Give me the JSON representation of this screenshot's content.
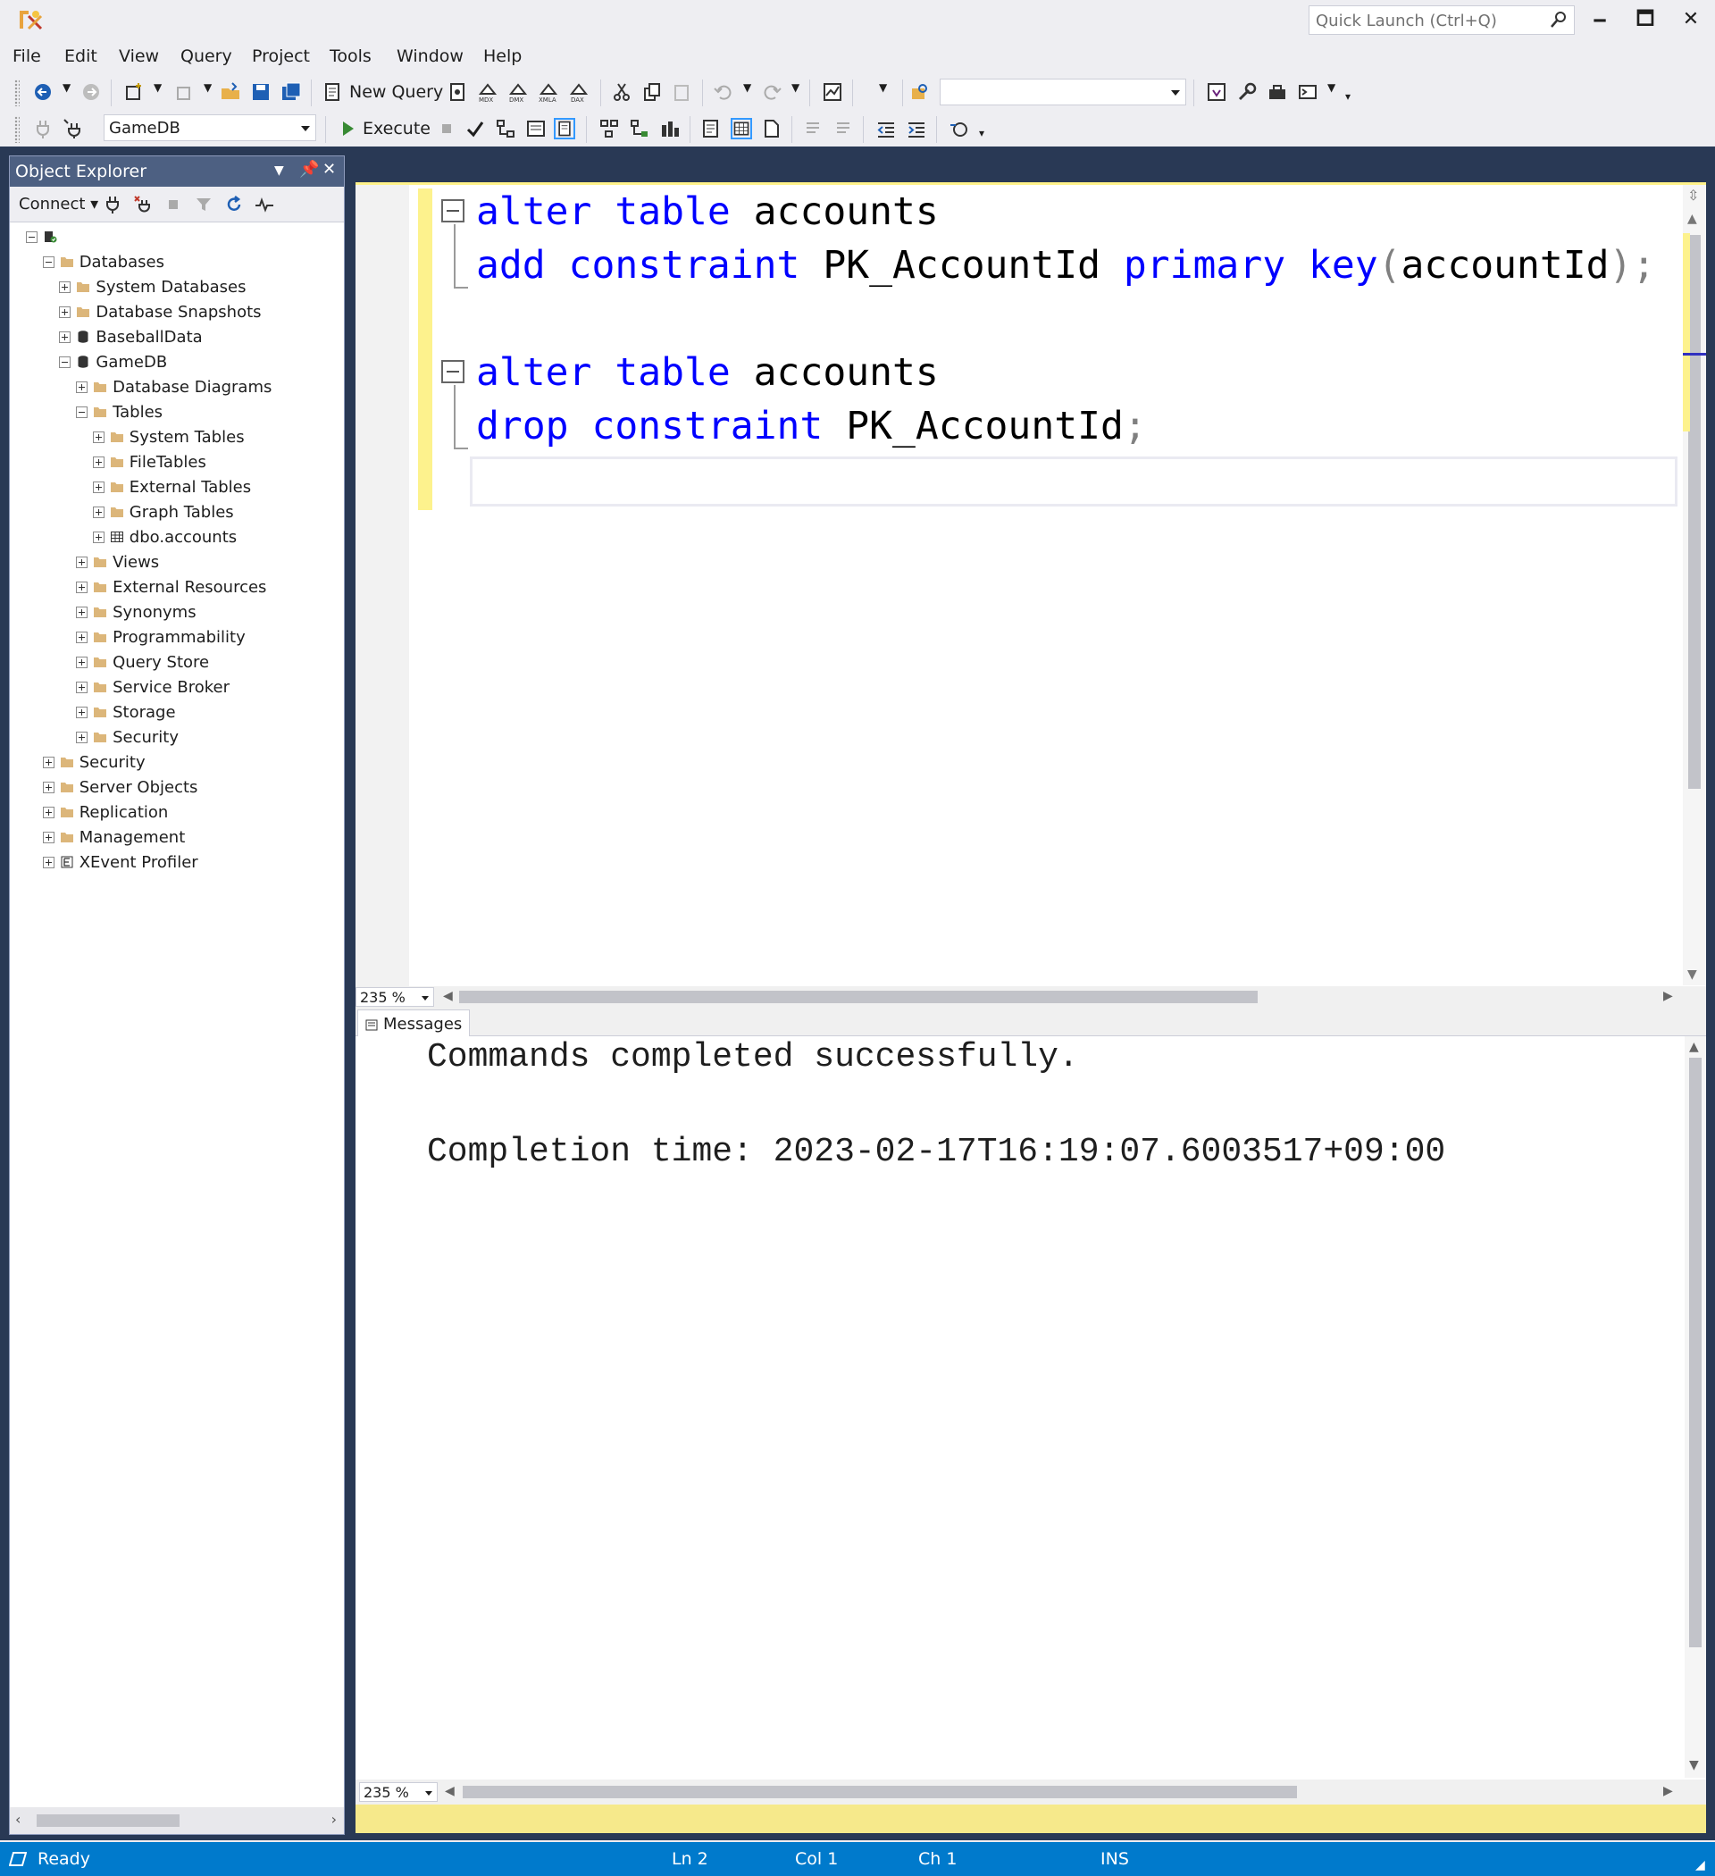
{
  "window": {
    "quick_launch_placeholder": "Quick Launch (Ctrl+Q)",
    "minimize": "🗕",
    "maximize": "🗖",
    "close": "✕"
  },
  "menu": [
    "File",
    "Edit",
    "View",
    "Query",
    "Project",
    "Tools",
    "Window",
    "Help"
  ],
  "toolbar": {
    "new_query_label": "New Query",
    "execute_label": "Execute",
    "database_combo": "GameDB",
    "solution_combo": ""
  },
  "object_explorer": {
    "title": "Object Explorer",
    "connect_label": "Connect",
    "tree": [
      {
        "label": "",
        "icon": "server-icon"
      },
      {
        "label": "Databases",
        "icon": "folder-icon"
      },
      {
        "label": "System Databases",
        "icon": "folder-icon"
      },
      {
        "label": "Database Snapshots",
        "icon": "folder-icon"
      },
      {
        "label": "BaseballData",
        "icon": "database-icon"
      },
      {
        "label": "GameDB",
        "icon": "database-icon"
      },
      {
        "label": "Database Diagrams",
        "icon": "folder-icon"
      },
      {
        "label": "Tables",
        "icon": "folder-icon"
      },
      {
        "label": "System Tables",
        "icon": "folder-icon"
      },
      {
        "label": "FileTables",
        "icon": "folder-icon"
      },
      {
        "label": "External Tables",
        "icon": "folder-icon"
      },
      {
        "label": "Graph Tables",
        "icon": "folder-icon"
      },
      {
        "label": "dbo.accounts",
        "icon": "table-icon"
      },
      {
        "label": "Views",
        "icon": "folder-icon"
      },
      {
        "label": "External Resources",
        "icon": "folder-icon"
      },
      {
        "label": "Synonyms",
        "icon": "folder-icon"
      },
      {
        "label": "Programmability",
        "icon": "folder-icon"
      },
      {
        "label": "Query Store",
        "icon": "folder-icon"
      },
      {
        "label": "Service Broker",
        "icon": "folder-icon"
      },
      {
        "label": "Storage",
        "icon": "folder-icon"
      },
      {
        "label": "Security",
        "icon": "folder-icon"
      },
      {
        "label": "Security",
        "icon": "folder-icon"
      },
      {
        "label": "Server Objects",
        "icon": "folder-icon"
      },
      {
        "label": "Replication",
        "icon": "folder-icon"
      },
      {
        "label": "Management",
        "icon": "folder-icon"
      },
      {
        "label": "XEvent Profiler",
        "icon": "xevent-icon"
      }
    ]
  },
  "editor": {
    "line1_kw": "alter table",
    "line1_rest": " accounts",
    "line2_kw1": "add constraint",
    "line2_name": " PK_AccountId ",
    "line2_kw2": "primary key",
    "line2_open": "(",
    "line2_col": "accountId",
    "line2_close": ");",
    "line4_kw": "alter table",
    "line4_rest": " accounts",
    "line5_kw": "drop constraint",
    "line5_name": " PK_AccountId",
    "line5_semi": ";",
    "zoom": "235 %"
  },
  "messages": {
    "tab_label": "Messages",
    "line1": "Commands completed successfully.",
    "line2": "Completion time: 2023-02-17T16:19:07.6003517+09:00",
    "zoom": "235 %"
  },
  "status": {
    "ready": "Ready",
    "ln": "Ln 2",
    "col": "Col 1",
    "ch": "Ch 1",
    "ins": "INS"
  },
  "colors": {
    "keyword": "#0000ff",
    "status_bar": "#007acc",
    "workspace": "#293955"
  }
}
